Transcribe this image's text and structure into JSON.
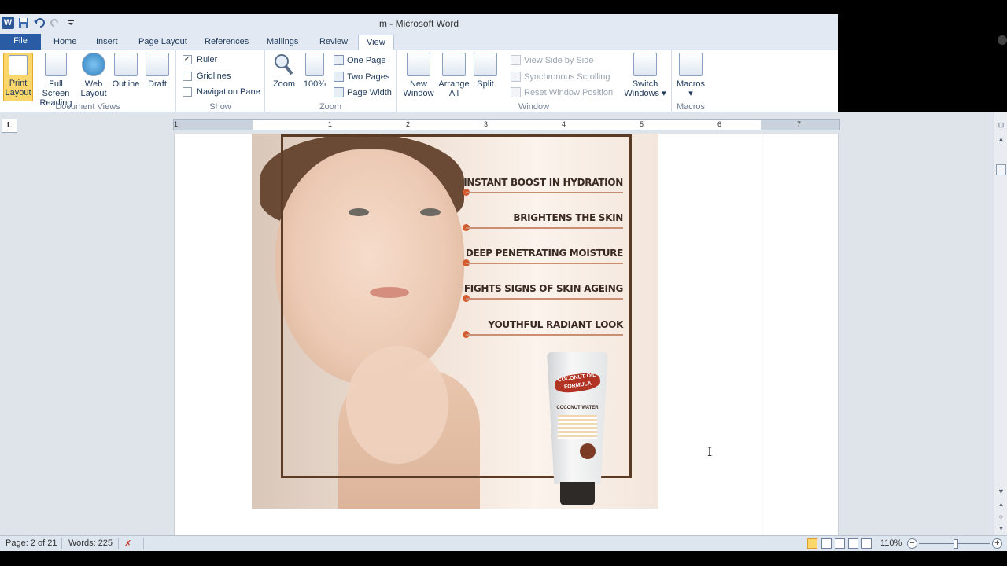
{
  "window": {
    "title": "m  -  Microsoft Word"
  },
  "qat": {
    "icons": [
      "word-logo-icon",
      "save-icon",
      "undo-icon",
      "redo-icon",
      "customize-icon"
    ]
  },
  "tabs": [
    "File",
    "Home",
    "Insert",
    "Page Layout",
    "References",
    "Mailings",
    "Review",
    "View"
  ],
  "active_tab": "View",
  "ribbon": {
    "document_views": {
      "label": "Document Views",
      "buttons": [
        "Print\nLayout",
        "Full Screen\nReading",
        "Web\nLayout",
        "Outline",
        "Draft"
      ],
      "print_layout": "Print",
      "print_layout2": "Layout",
      "full_screen": "Full Screen",
      "full_screen2": "Reading",
      "web_layout": "Web",
      "web_layout2": "Layout",
      "outline": "Outline",
      "draft": "Draft"
    },
    "show": {
      "label": "Show",
      "ruler": "Ruler",
      "gridlines": "Gridlines",
      "navigation_pane": "Navigation Pane",
      "ruler_checked": true
    },
    "zoom": {
      "label": "Zoom",
      "zoom": "Zoom",
      "hundred": "100%",
      "one_page": "One Page",
      "two_pages": "Two Pages",
      "page_width": "Page Width"
    },
    "window": {
      "label": "Window",
      "new_window": "New",
      "new_window2": "Window",
      "arrange_all": "Arrange",
      "arrange_all2": "All",
      "split": "Split",
      "view_side_by_side": "View Side by Side",
      "sync_scrolling": "Synchronous Scrolling",
      "reset_window": "Reset Window Position",
      "switch_windows": "Switch",
      "switch_windows2": "Windows"
    },
    "macros": {
      "label": "Macros",
      "macros": "Macros"
    }
  },
  "ruler": {
    "numbers": [
      "1",
      "1",
      "2",
      "3",
      "4",
      "5",
      "6",
      "7"
    ]
  },
  "ad": {
    "claims": [
      "INSTANT BOOST IN HYDRATION",
      "BRIGHTENS THE SKIN",
      "DEEP PENETRATING MOISTURE",
      "FIGHTS SIGNS OF SKIN AGEING",
      "YOUTHFUL RADIANT LOOK"
    ],
    "product_brand": "COCONUT OIL FORMULA",
    "product_name": "COCONUT WATER"
  },
  "status": {
    "page": "Page: 2 of 21",
    "words": "Words: 225",
    "zoom": "110%"
  },
  "colors": {
    "file_tab": "#2a5ba5",
    "ribbon_bg": "#ffffff",
    "accent_dot": "#d55b2e",
    "frame": "#5a3b26"
  }
}
